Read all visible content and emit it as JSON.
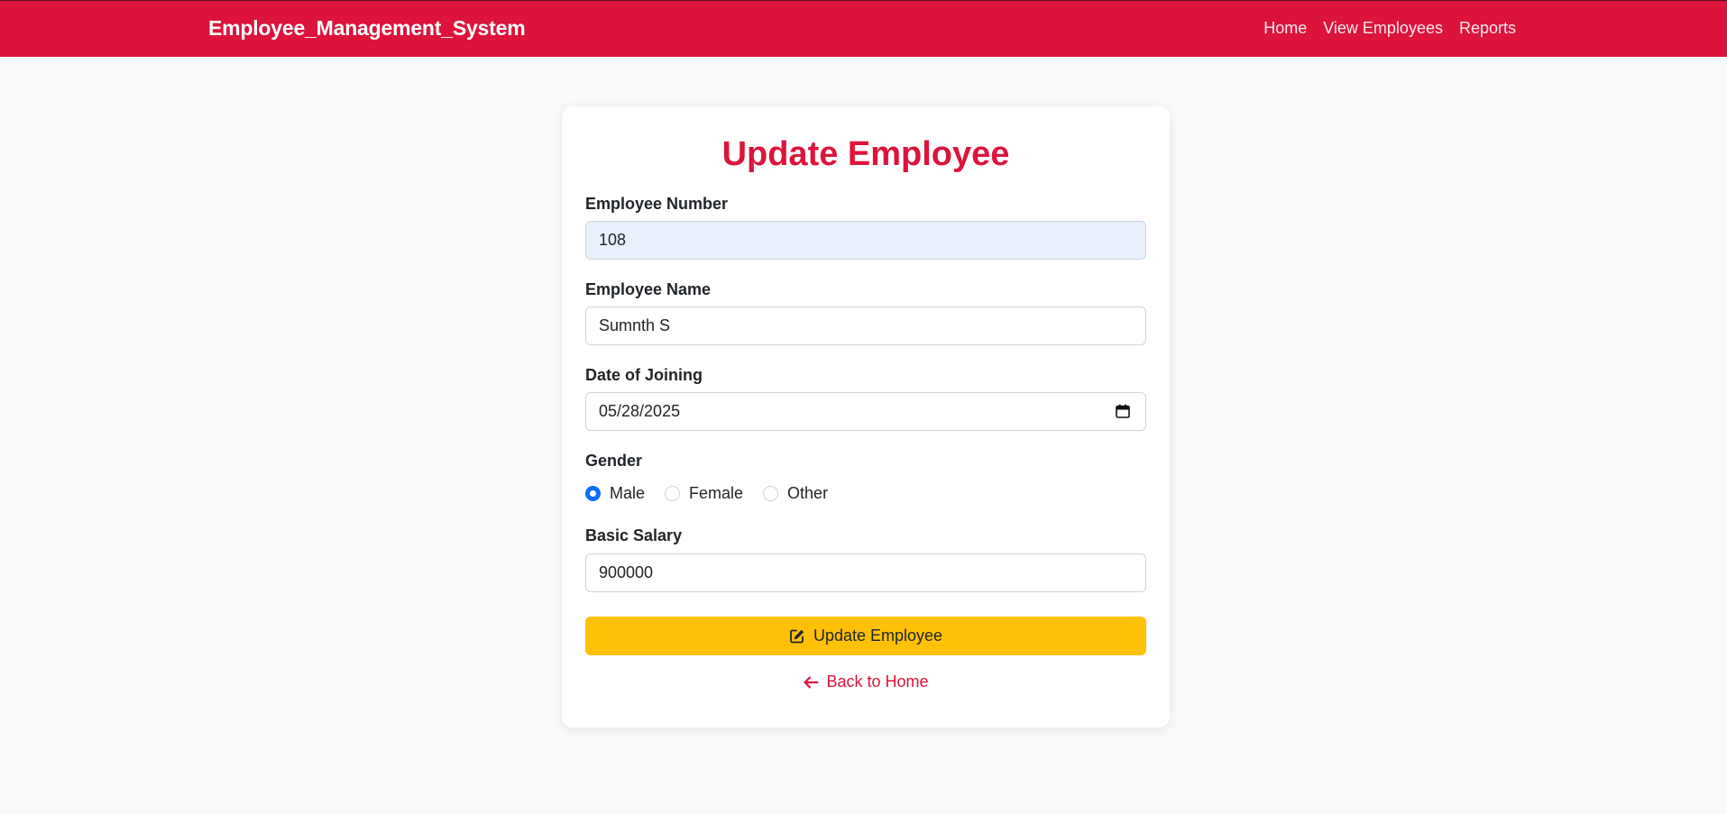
{
  "navbar": {
    "brand": "Employee_Management_System",
    "links": [
      "Home",
      "View Employees",
      "Reports"
    ]
  },
  "form": {
    "title": "Update Employee",
    "employee_number": {
      "label": "Employee Number",
      "value": "108"
    },
    "employee_name": {
      "label": "Employee Name",
      "value": "Sumnth S"
    },
    "date_of_joining": {
      "label": "Date of Joining",
      "value": "05/28/2025"
    },
    "gender": {
      "label": "Gender",
      "options": [
        "Male",
        "Female",
        "Other"
      ],
      "selected": "Male"
    },
    "basic_salary": {
      "label": "Basic Salary",
      "value": "900000"
    },
    "submit_label": "Update Employee",
    "back_label": "Back to Home"
  },
  "colors": {
    "brand": "#dc143c",
    "button": "#ffc107",
    "radio_checked": "#0d6efd",
    "autofill": "#e8f0fe"
  },
  "icons": {
    "submit": "edit-icon",
    "back": "arrow-left-icon",
    "date": "calendar-icon"
  }
}
